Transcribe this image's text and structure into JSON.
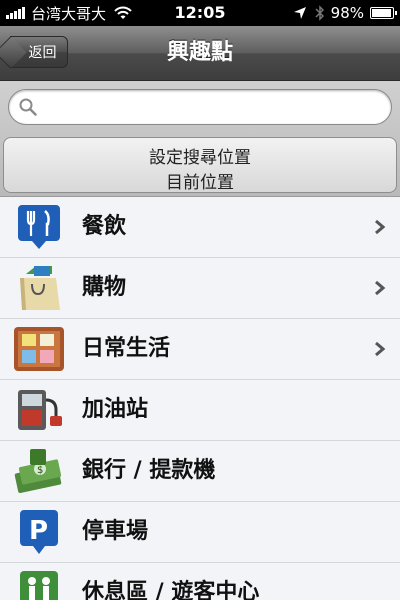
{
  "status_bar": {
    "carrier": "台湾大哥大",
    "time": "12:05",
    "battery": "98%",
    "battery_level": 0.98
  },
  "nav": {
    "title": "興趣點",
    "back_label": "返回"
  },
  "search": {
    "value": "",
    "placeholder": ""
  },
  "location_button": {
    "line1": "設定搜尋位置",
    "line2": "目前位置"
  },
  "categories": [
    {
      "label": "餐飲",
      "icon": "dining-icon",
      "has_chevron": true
    },
    {
      "label": "購物",
      "icon": "shopping-bag-icon",
      "has_chevron": true
    },
    {
      "label": "日常生活",
      "icon": "notes-board-icon",
      "has_chevron": true
    },
    {
      "label": "加油站",
      "icon": "gas-pump-icon",
      "has_chevron": false
    },
    {
      "label": "銀行 / 提款機",
      "icon": "money-icon",
      "has_chevron": false
    },
    {
      "label": "停車場",
      "icon": "parking-icon",
      "has_chevron": false
    },
    {
      "label": "休息區 / 遊客中心",
      "icon": "restroom-icon",
      "has_chevron": false
    }
  ],
  "colors": {
    "nav_bar": "#4b4b4b",
    "list_background": "#f2f4f8",
    "pin_blue": "#1f5fb8"
  }
}
